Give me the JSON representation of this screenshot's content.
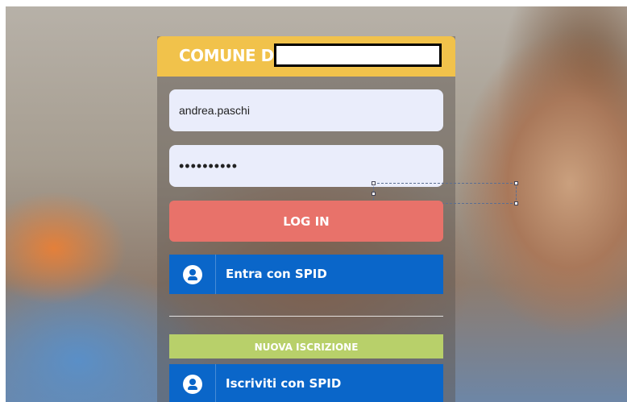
{
  "header": {
    "title": "COMUNE DI",
    "brand_color": "#f1c24b"
  },
  "login_form": {
    "username_value": "andrea.paschi",
    "password_value": "••••••••••",
    "login_label": "LOG IN",
    "spid_login_label": "Entra con SPID",
    "new_registration_label": "NUOVA ISCRIZIONE",
    "spid_register_label": "Iscriviti con SPID"
  },
  "colors": {
    "login_button": "#e8726a",
    "spid_button": "#0a66c9",
    "registration_bar": "#b8d06a",
    "input_bg": "#eaedfb"
  },
  "icons": {
    "spid": "user-icon"
  }
}
